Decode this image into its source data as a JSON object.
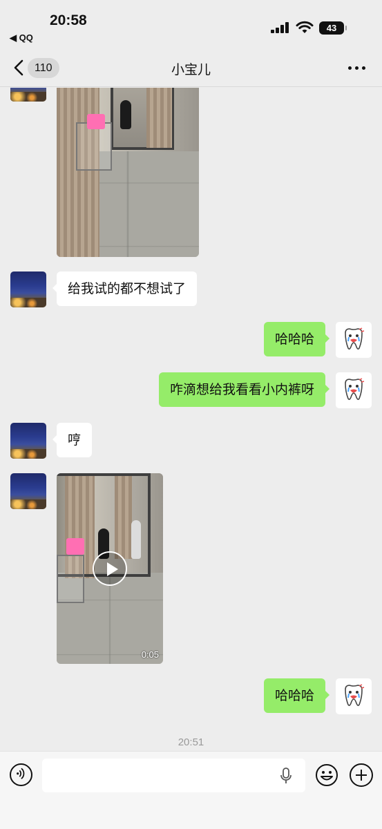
{
  "status_bar": {
    "time": "20:58",
    "back_app": "◀ QQ",
    "battery": "43"
  },
  "nav": {
    "unread_count": "110",
    "title": "小宝儿"
  },
  "messages": [
    {
      "side": "left",
      "type": "image"
    },
    {
      "side": "left",
      "type": "text",
      "text": "给我试的都不想试了"
    },
    {
      "side": "right",
      "type": "text",
      "text": "哈哈哈"
    },
    {
      "side": "right",
      "type": "text",
      "text": "咋滴想给我看看小内裤呀"
    },
    {
      "side": "left",
      "type": "text",
      "text": "哼"
    },
    {
      "side": "left",
      "type": "video",
      "duration": "0:05"
    },
    {
      "side": "right",
      "type": "text",
      "text": "哈哈哈"
    }
  ],
  "timestamp": "20:51",
  "colors": {
    "background": "#ededed",
    "bubble_self": "#95ec69",
    "bubble_other": "#ffffff"
  },
  "icons": {
    "back": "chevron-left-icon",
    "more": "more-dots-icon",
    "voice": "voice-icon",
    "mic": "mic-icon",
    "emoji": "emoji-icon",
    "plus": "plus-icon",
    "play": "play-icon"
  }
}
